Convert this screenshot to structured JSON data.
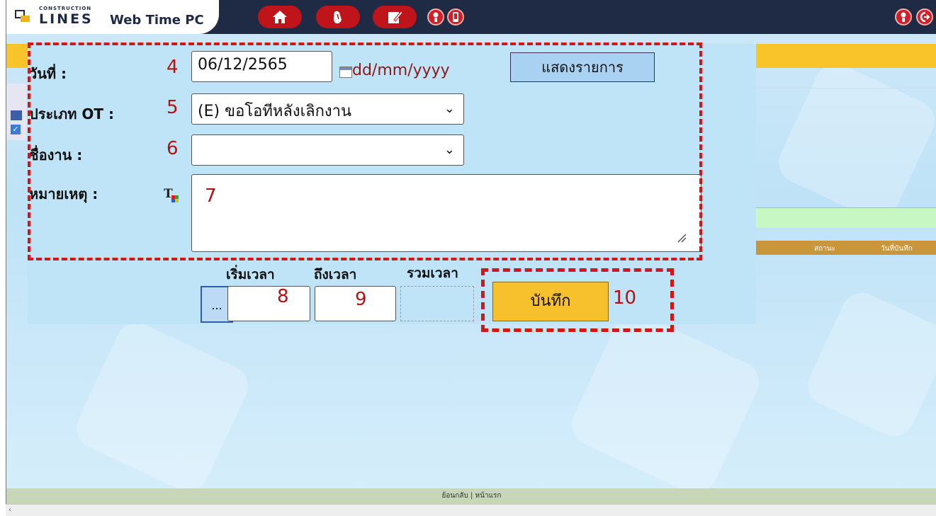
{
  "header": {
    "logo_small": "CONSTRUCTION",
    "logo_lines": "LINES",
    "app_title": "Web Time PC",
    "nav_icons": [
      "home-icon",
      "hand-icon",
      "edit-icon",
      "user-icon",
      "phone-icon"
    ],
    "right_icons": [
      "user-icon",
      "logout-icon"
    ]
  },
  "form": {
    "date_label": "วันที่ :",
    "date_value": "06/12/2565",
    "date_hint": "dd/mm/yyyy",
    "show_button": "แสดงรายการ",
    "ot_type_label": "ประเภท OT :",
    "ot_type_value": "(E) ขอโอทีหลังเลิกงาน",
    "job_label": "ชื่องาน :",
    "job_value": "",
    "remark_label": "หมายเหตุ :",
    "remark_value": "",
    "start_time_label": "เริ่มเวลา",
    "end_time_label": "ถึงเวลา",
    "total_time_label": "รวมเวลา",
    "dots_button": "...",
    "save_button": "บันทึก"
  },
  "annotations": {
    "n4": "4",
    "n5": "5",
    "n6": "6",
    "n7": "7",
    "n8": "8",
    "n9": "9",
    "n10": "10"
  },
  "table": {
    "col_status": "สถานะ",
    "col_saved_date": "วันที่บันทึก"
  },
  "footer": {
    "back": "ย้อนกลับ",
    "sep": "|",
    "home": "หน้าแรก"
  },
  "colors": {
    "topbar": "#1f2a44",
    "nav_red": "#c0141b",
    "accent_yellow": "#f8c42a",
    "annotation_red": "#d01818"
  }
}
